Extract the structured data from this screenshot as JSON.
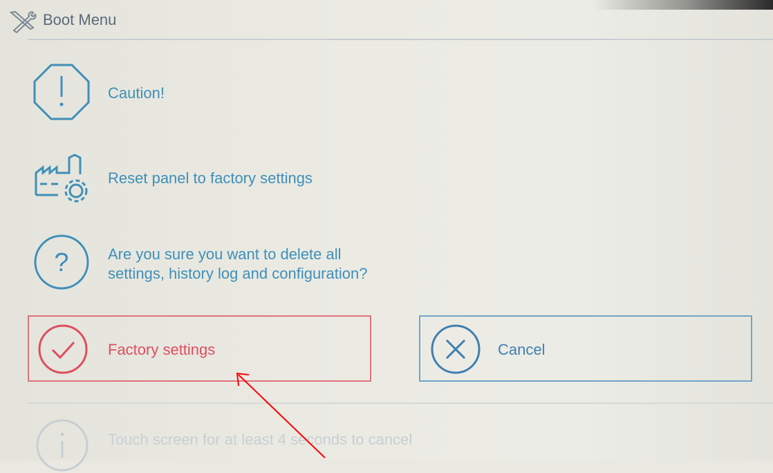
{
  "window": {
    "title": "Boot Menu",
    "title_icon": "tools-icon"
  },
  "rows": {
    "caution": {
      "text": "Caution!",
      "icon": "warning-octagon-icon"
    },
    "reset": {
      "text": "Reset panel to factory settings",
      "icon": "factory-gear-icon"
    },
    "question": {
      "line1": "Are you sure you want to delete all",
      "line2": "settings, history log and configuration?",
      "icon": "question-circle-icon"
    }
  },
  "buttons": {
    "factory": {
      "label": "Factory settings",
      "icon": "check-circle-icon",
      "color": "#de4e5e"
    },
    "cancel": {
      "label": "Cancel",
      "icon": "x-circle-icon",
      "color": "#3f7fb0"
    }
  },
  "footer": {
    "text": "Touch screen for at least 4 seconds to cancel",
    "icon": "info-circle-icon"
  },
  "colors": {
    "accent_blue": "#3f8fb8",
    "accent_red": "#de4e5e",
    "annotation_arrow": "#ff0000"
  }
}
